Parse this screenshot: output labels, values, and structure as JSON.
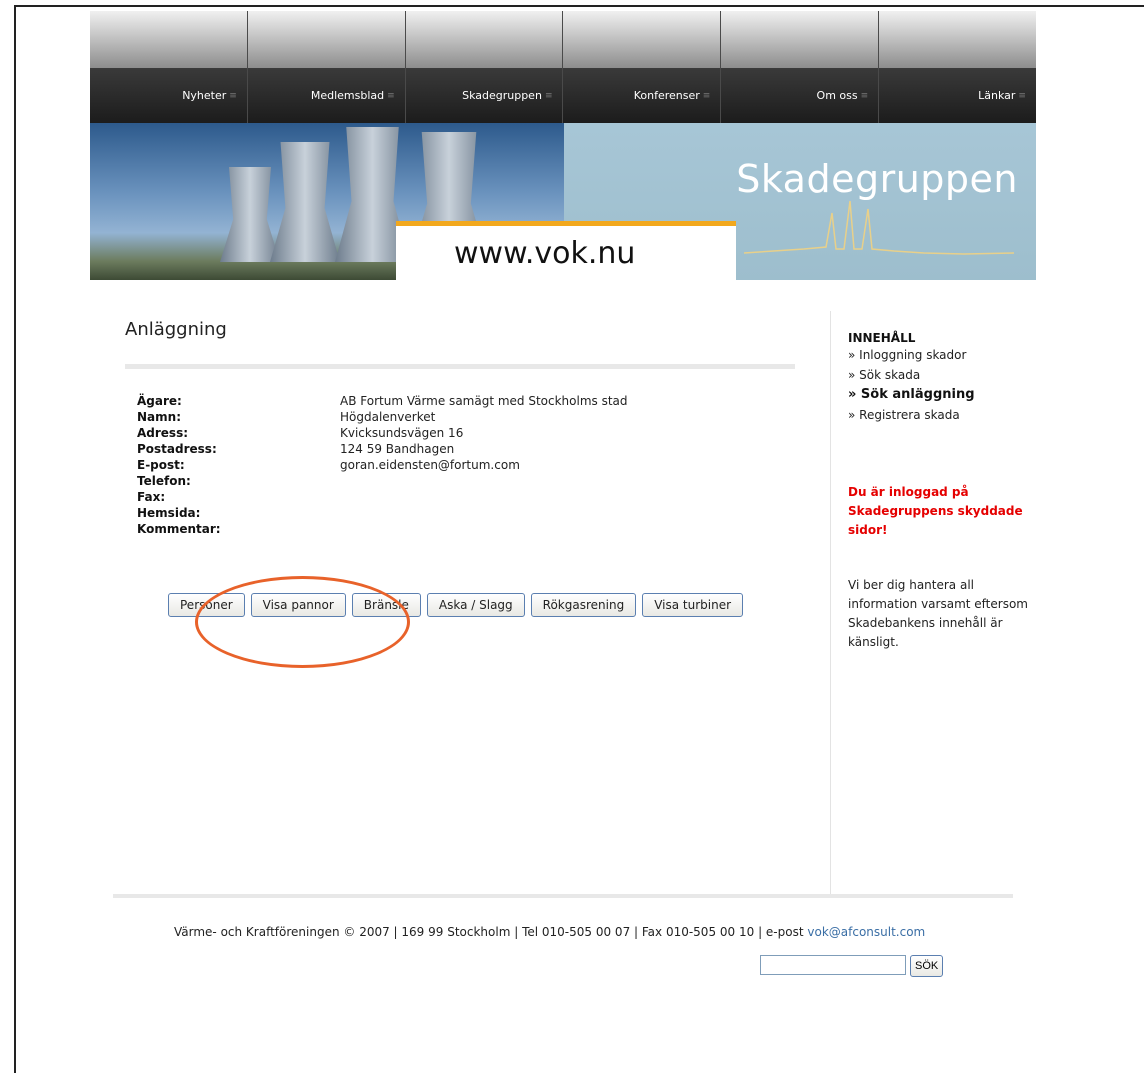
{
  "nav": {
    "items": [
      {
        "label": "Nyheter"
      },
      {
        "label": "Medlemsblad"
      },
      {
        "label": "Skadegruppen"
      },
      {
        "label": "Konferenser"
      },
      {
        "label": "Om oss"
      },
      {
        "label": "Länkar"
      }
    ],
    "separator": "≡"
  },
  "banner": {
    "brand": "Skadegruppen",
    "url": "www.vok.nu"
  },
  "main": {
    "heading": "Anläggning",
    "fields": [
      {
        "label": "Ägare:",
        "value": "AB Fortum Värme samägt med Stockholms stad"
      },
      {
        "label": "Namn:",
        "value": "Högdalenverket"
      },
      {
        "label": "Adress:",
        "value": "Kvicksundsvägen 16"
      },
      {
        "label": "Postadress:",
        "value": "124 59 Bandhagen"
      },
      {
        "label": "E-post:",
        "value": "goran.eidensten@fortum.com"
      },
      {
        "label": "Telefon:",
        "value": ""
      },
      {
        "label": "Fax:",
        "value": ""
      },
      {
        "label": "Hemsida:",
        "value": ""
      },
      {
        "label": "Kommentar:",
        "value": ""
      }
    ],
    "buttons": [
      "Personer",
      "Visa pannor",
      "Bränsle",
      "Aska / Slagg",
      "Rökgasrening",
      "Visa turbiner"
    ]
  },
  "sidebar": {
    "heading": "INNEHÅLL",
    "items": [
      {
        "label": "» Inloggning skador",
        "active": false
      },
      {
        "label": "» Sök skada",
        "active": false
      },
      {
        "label": "» Sök anläggning",
        "active": true
      },
      {
        "label": "» Registrera skada",
        "active": false
      }
    ],
    "notice": "Du är inloggad på Skadegruppens skyddade sidor!",
    "info": "Vi ber dig hantera all information varsamt eftersom Skadebankens innehåll är känsligt."
  },
  "footer": {
    "text": "Värme- och Kraftföreningen © 2007 | 169 99 Stockholm | Tel 010-505 00 07 | Fax 010-505 00 10 | e-post ",
    "email": "vok@afconsult.com",
    "search_button": "SÖK"
  },
  "colors": {
    "accent_orange": "#f2a81d",
    "notice_red": "#e50000",
    "annotation": "#e8622a"
  }
}
